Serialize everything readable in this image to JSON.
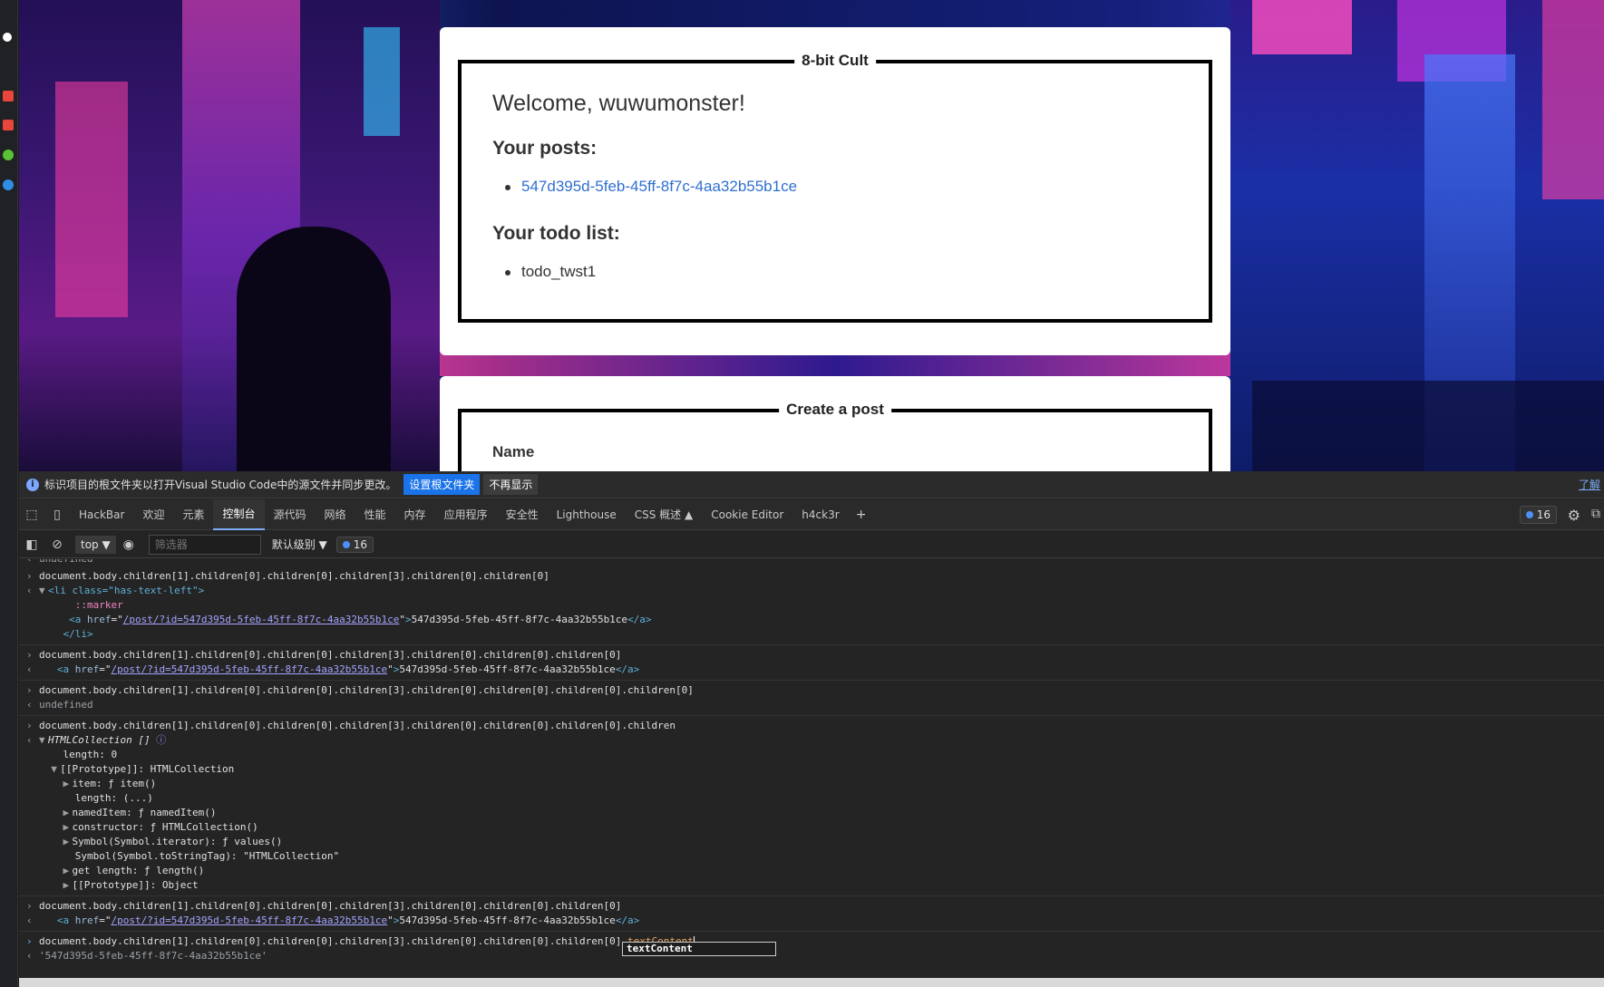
{
  "page": {
    "card1_legend": "8-bit Cult",
    "welcome": "Welcome, wuwumonster!",
    "posts_heading": "Your posts:",
    "post_link": "547d395d-5feb-45ff-8f7c-4aa32b55b1ce",
    "todo_heading": "Your todo list:",
    "todo_item": "todo_twst1",
    "card2_legend": "Create a post",
    "name_label": "Name"
  },
  "infobar": {
    "message": "标识项目的根文件夹以打开Visual Studio Code中的源文件并同步更改。",
    "primary_button": "设置根文件夹",
    "secondary_button": "不再显示",
    "learn_more": "了解"
  },
  "tabs": [
    "HackBar",
    "欢迎",
    "元素",
    "控制台",
    "源代码",
    "网络",
    "性能",
    "内存",
    "应用程序",
    "安全性",
    "Lighthouse",
    "CSS 概述 ▲",
    "Cookie Editor",
    "h4ck3r"
  ],
  "active_tab": "控制台",
  "issues_count": "16",
  "toolbar": {
    "context": "top",
    "filter_placeholder": "筛选器",
    "level": "默认级别",
    "message_count": "16"
  },
  "console": {
    "top_undefined": "undefined",
    "cmd_base": "document.body.children[1].children[0].children[0].children[3].children[0].children[0]",
    "li_open": "<li class=\"has-text-left\">",
    "marker": "::marker",
    "href": "/post/?id=547d395d-5feb-45ff-8f7c-4aa32b55b1ce",
    "anchor_text": "547d395d-5feb-45ff-8f7c-4aa32b55b1ce",
    "li_close": "</li>",
    "undefined": "undefined",
    "collection_header": "HTMLCollection []",
    "length_line": "length: 0",
    "proto_line": "[[Prototype]]: HTMLCollection",
    "proto_items": [
      "item: ƒ item()",
      "length: (...)",
      "namedItem: ƒ namedItem()",
      "constructor: ƒ HTMLCollection()",
      "Symbol(Symbol.iterator): ƒ values()",
      "Symbol(Symbol.toStringTag): \"HTMLCollection\"",
      "get length: ƒ length()",
      "[[Prototype]]: Object"
    ],
    "autocomplete": "textContent",
    "result_string": "'547d395d-5feb-45ff-8f7c-4aa32b55b1ce'"
  }
}
